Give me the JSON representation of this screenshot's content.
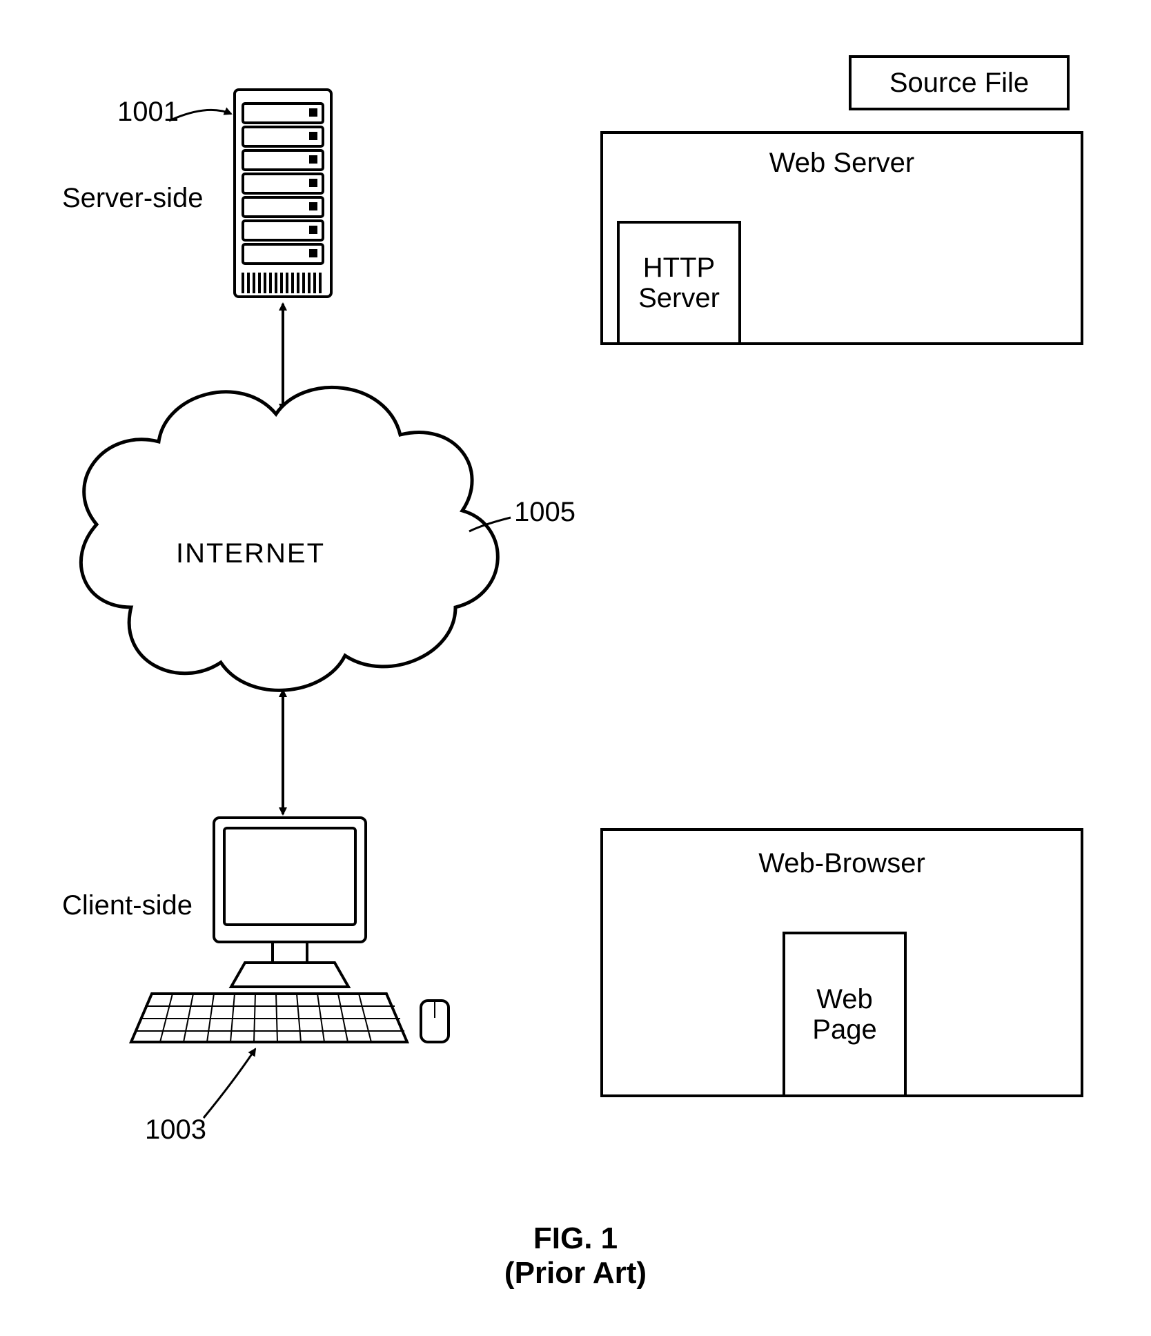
{
  "figure": {
    "title_line1": "FIG. 1",
    "title_line2": "(Prior Art)"
  },
  "labels": {
    "server_side": "Server-side",
    "client_side": "Client-side",
    "internet": "INTERNET",
    "ref_1001": "1001",
    "ref_1003": "1003",
    "ref_1005": "1005"
  },
  "boxes": {
    "source_file": "Source File",
    "web_server": "Web Server",
    "http_server_line1": "HTTP",
    "http_server_line2": "Server",
    "web_browser": "Web-Browser",
    "web_page_line1": "Web",
    "web_page_line2": "Page"
  }
}
